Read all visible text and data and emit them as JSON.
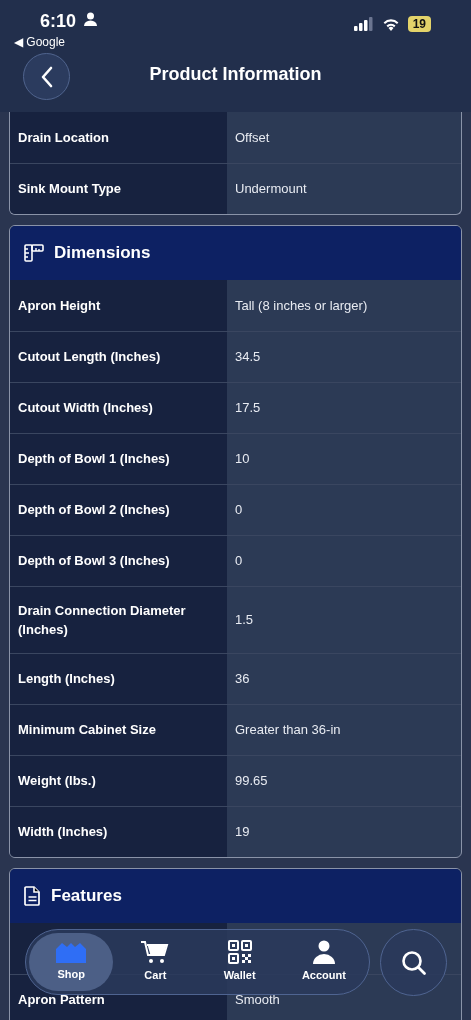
{
  "status_bar": {
    "time": "6:10",
    "back_app": "◀ Google",
    "battery": "19"
  },
  "header": {
    "title": "Product Information"
  },
  "sections": [
    {
      "rows": [
        {
          "label": "Drain Location",
          "value": "Offset"
        },
        {
          "label": "Sink Mount Type",
          "value": "Undermount"
        }
      ]
    },
    {
      "title": "Dimensions",
      "rows": [
        {
          "label": "Apron Height",
          "value": "Tall (8 inches or larger)"
        },
        {
          "label": "Cutout Length (Inches)",
          "value": "34.5"
        },
        {
          "label": "Cutout Width (Inches)",
          "value": "17.5"
        },
        {
          "label": "Depth of Bowl 1 (Inches)",
          "value": "10"
        },
        {
          "label": "Depth of Bowl 2 (Inches)",
          "value": "0"
        },
        {
          "label": "Depth of Bowl 3 (Inches)",
          "value": "0"
        },
        {
          "label": "Drain Connection Diameter (Inches)",
          "value": "1.5"
        },
        {
          "label": "Length (Inches)",
          "value": "36"
        },
        {
          "label": "Minimum Cabinet Size",
          "value": "Greater than 36-in"
        },
        {
          "label": "Weight (lbs.)",
          "value": "99.65"
        },
        {
          "label": "Width (Inches)",
          "value": "19"
        }
      ]
    },
    {
      "title": "Features",
      "rows": [
        {
          "label": "Apron Pattern",
          "value": "Smooth"
        }
      ]
    }
  ],
  "tab_bar": [
    {
      "label": "Shop",
      "selected": true
    },
    {
      "label": "Cart",
      "selected": false
    },
    {
      "label": "Wallet",
      "selected": false
    },
    {
      "label": "Account",
      "selected": false
    }
  ]
}
